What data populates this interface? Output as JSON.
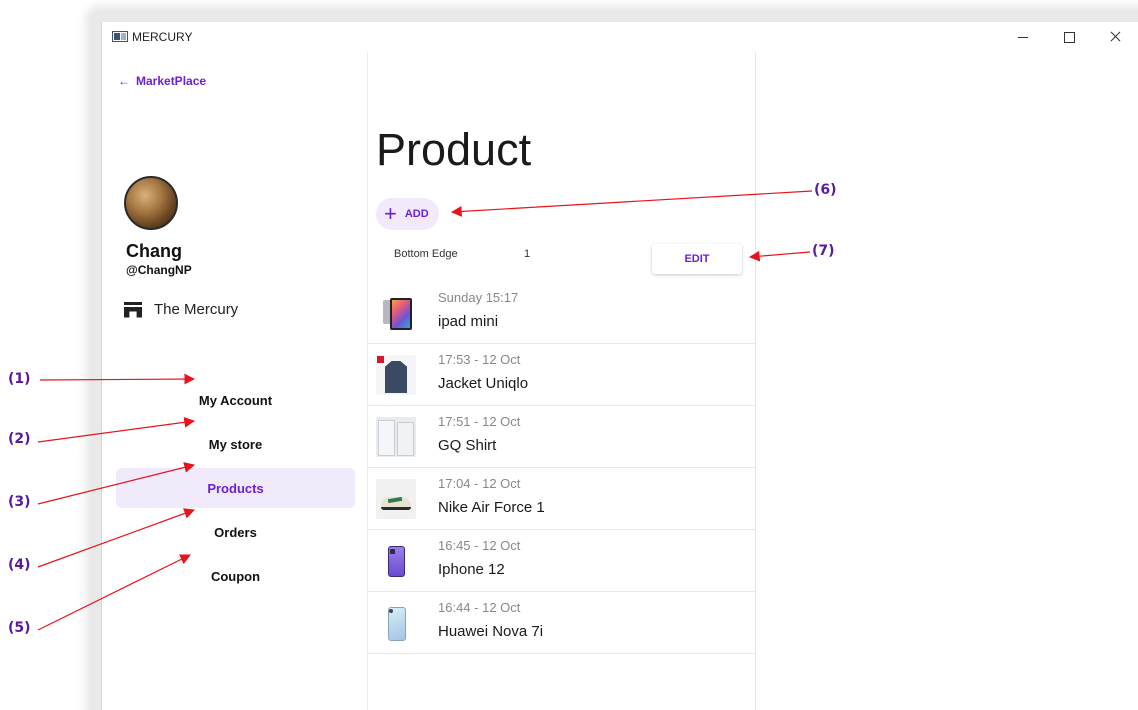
{
  "window": {
    "title": "MERCURY"
  },
  "sidebar": {
    "back_label": "MarketPlace",
    "user": {
      "name": "Chang",
      "handle": "@ChangNP"
    },
    "store_name": "The Mercury",
    "nav": [
      {
        "label": "My Account",
        "active": false
      },
      {
        "label": "My store",
        "active": false
      },
      {
        "label": "Products",
        "active": true
      },
      {
        "label": "Orders",
        "active": false
      },
      {
        "label": "Coupon",
        "active": false
      }
    ]
  },
  "main": {
    "title": "Product",
    "add_label": "ADD",
    "edge_label": "Bottom Edge",
    "edge_value": "1",
    "edit_label": "EDIT",
    "products": [
      {
        "time": "Sunday 15:17",
        "name": "ipad mini",
        "thumb": "ipad"
      },
      {
        "time": "17:53 - 12 Oct",
        "name": "Jacket Uniqlo",
        "thumb": "jacket"
      },
      {
        "time": "17:51 - 12 Oct",
        "name": "GQ Shirt",
        "thumb": "shirt"
      },
      {
        "time": "17:04 - 12 Oct",
        "name": "Nike Air Force 1",
        "thumb": "nike"
      },
      {
        "time": "16:45 - 12 Oct",
        "name": "Iphone 12",
        "thumb": "iphone"
      },
      {
        "time": "16:44 - 12 Oct",
        "name": "Huawei Nova 7i",
        "thumb": "huawei"
      }
    ]
  },
  "annotations": {
    "a1": "(1)",
    "a2": "(2)",
    "a3": "(3)",
    "a4": "(4)",
    "a5": "(5)",
    "a6": "(6)",
    "a7": "(7)"
  },
  "colors": {
    "accent": "#6b1fd6",
    "active_bg": "#f1eafb",
    "annotation": "#5a1a9c",
    "arrow": "#e8141c"
  }
}
